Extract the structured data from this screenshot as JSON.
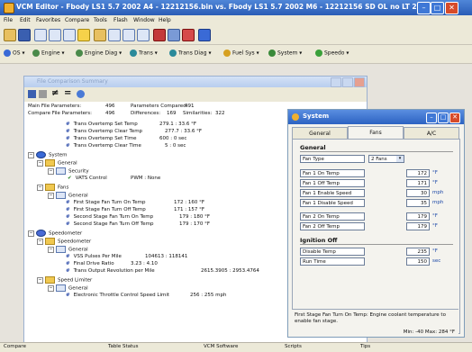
{
  "window": {
    "title": "VCM Editor - Fbody LS1 5.7 2002 A4 - 12212156.bin  vs.  Fbody LS1 5.7 2002 M6 - 12212156 SD OL no LT 2..."
  },
  "menu": [
    "File",
    "Edit",
    "Favorites",
    "Compare",
    "Tools",
    "Flash",
    "Window",
    "Help"
  ],
  "toolbar2": [
    "OS",
    "Engine",
    "Engine Diag",
    "Trans",
    "Trans Diag",
    "Fuel Sys",
    "System",
    "Speedo"
  ],
  "comparison": {
    "title": "File Comparison Summary",
    "file_params_label": "Main File Parameters:",
    "file_params_value": "496",
    "params_compared_label": "Parameters Compared:",
    "params_compared_value": "491",
    "compare_params_label": "Compare File Parameters:",
    "compare_params_value": "496",
    "differences_label": "Differences:",
    "differences_value": "169",
    "similarities_label": "Similarities:",
    "similarities_value": "322"
  },
  "tree": [
    {
      "label": "Trans Overtemp Set Temp",
      "value": "279.1 : 33.6 °F"
    },
    {
      "label": "Trans Overtemp Clear Temp",
      "value": "277.7 : 33.6 °F"
    },
    {
      "label": "Trans Overtemp Set Time",
      "value": "600 : 0 sec"
    },
    {
      "label": "Trans Overtemp Clear Time",
      "value": "5 : 0 sec"
    },
    {
      "label": "System"
    },
    {
      "label": "General"
    },
    {
      "label": "Security"
    },
    {
      "label": "VATS Control",
      "value": "PWM : None"
    },
    {
      "label": "Fans"
    },
    {
      "label": "General"
    },
    {
      "label": "First Stage Fan Turn On Temp",
      "value": "172 : 160 °F"
    },
    {
      "label": "First Stage Fan Turn Off Temp",
      "value": "171 : 157 °F"
    },
    {
      "label": "Second Stage Fan Turn On Temp",
      "value": "179 : 180 °F"
    },
    {
      "label": "Second Stage Fan Turn Off Temp",
      "value": "179 : 170 °F"
    },
    {
      "label": "Speedometer"
    },
    {
      "label": "Speedometer"
    },
    {
      "label": "General"
    },
    {
      "label": "VSS Pulses Per Mile",
      "value": "104613 : 118141"
    },
    {
      "label": "Final Drive Ratio",
      "value": "3.23 : 4.10"
    },
    {
      "label": "Trans Output Revolution per Mile",
      "value": "2615.3905 : 2953.4764"
    },
    {
      "label": "Speed Limiter"
    },
    {
      "label": "General"
    },
    {
      "label": "Electronic Throttle Control Speed Limit",
      "value": "256 : 255 mph"
    }
  ],
  "status": [
    "Compare",
    "Table Status",
    "VCM Software",
    "Scripts",
    "Tips"
  ],
  "system": {
    "title": "System",
    "tabs": [
      "General",
      "Fans",
      "A/C"
    ],
    "section_general": "General",
    "fan_type_label": "Fan Type",
    "fan_type_value": "2 Fans",
    "fields": [
      {
        "label": "Fan 1 On Temp",
        "value": "172",
        "unit": "°F"
      },
      {
        "label": "Fan 1 Off Temp",
        "value": "171",
        "unit": "°F"
      },
      {
        "label": "Fan 1 Enable Speed",
        "value": "30",
        "unit": "mph"
      },
      {
        "label": "Fan 1 Disable Speed",
        "value": "35",
        "unit": "mph"
      },
      {
        "label": "Fan 2 On Temp",
        "value": "179",
        "unit": "°F"
      },
      {
        "label": "Fan 2 Off Temp",
        "value": "179",
        "unit": "°F"
      }
    ],
    "section_ignition": "Ignition Off",
    "ign_fields": [
      {
        "label": "Disable Temp",
        "value": "235",
        "unit": "°F"
      },
      {
        "label": "Run Time",
        "value": "150",
        "unit": "sec"
      }
    ],
    "description": "First Stage Fan Turn On Temp: Engine coolant temperature to enable fan stage.",
    "range": "Min: -40  Max: 284 °F"
  }
}
